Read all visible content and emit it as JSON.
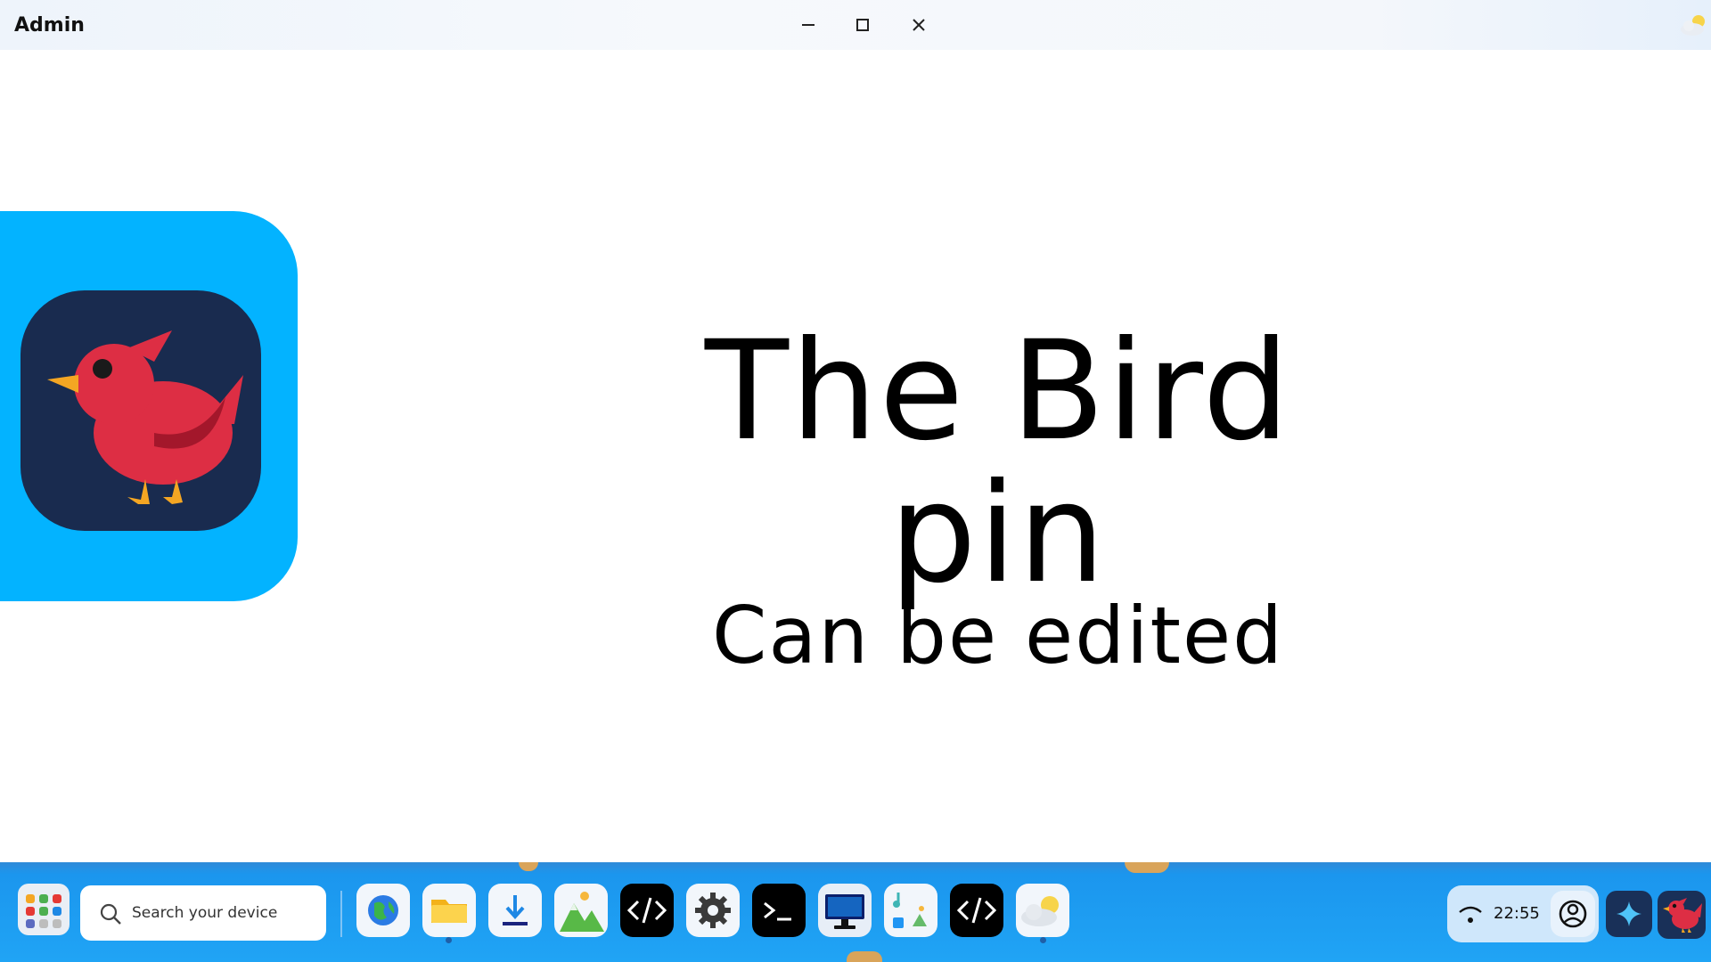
{
  "window": {
    "title": "Admin",
    "controls": [
      "minimize",
      "maximize",
      "close"
    ]
  },
  "main": {
    "heading": "The Bird pin",
    "subheading": "Can be edited",
    "pin_icon": "bird-icon",
    "colors": {
      "pin_card": "#03b3ff",
      "pin_icon_bg": "#192b4f",
      "bird": "#dd2e44",
      "beak": "#f4a623"
    }
  },
  "taskbar": {
    "search_placeholder": "Search your device",
    "apps": [
      {
        "name": "browser",
        "icon": "globe-icon"
      },
      {
        "name": "files",
        "icon": "folder-icon",
        "running": true
      },
      {
        "name": "downloads",
        "icon": "download-icon"
      },
      {
        "name": "photos",
        "icon": "mountain-icon"
      },
      {
        "name": "code-editor",
        "icon": "code-icon"
      },
      {
        "name": "settings",
        "icon": "gear-icon"
      },
      {
        "name": "terminal",
        "icon": "terminal-icon"
      },
      {
        "name": "display",
        "icon": "monitor-icon"
      },
      {
        "name": "media",
        "icon": "media-icon"
      },
      {
        "name": "code-editor-2",
        "icon": "code-icon"
      },
      {
        "name": "weather",
        "icon": "weather-icon",
        "running": true
      }
    ],
    "tray": {
      "clock": "22:55",
      "wifi_icon": "wifi-icon",
      "account_icon": "account-icon"
    },
    "assistant_icon": "sparkle-icon",
    "bird_icon": "bird-icon"
  }
}
